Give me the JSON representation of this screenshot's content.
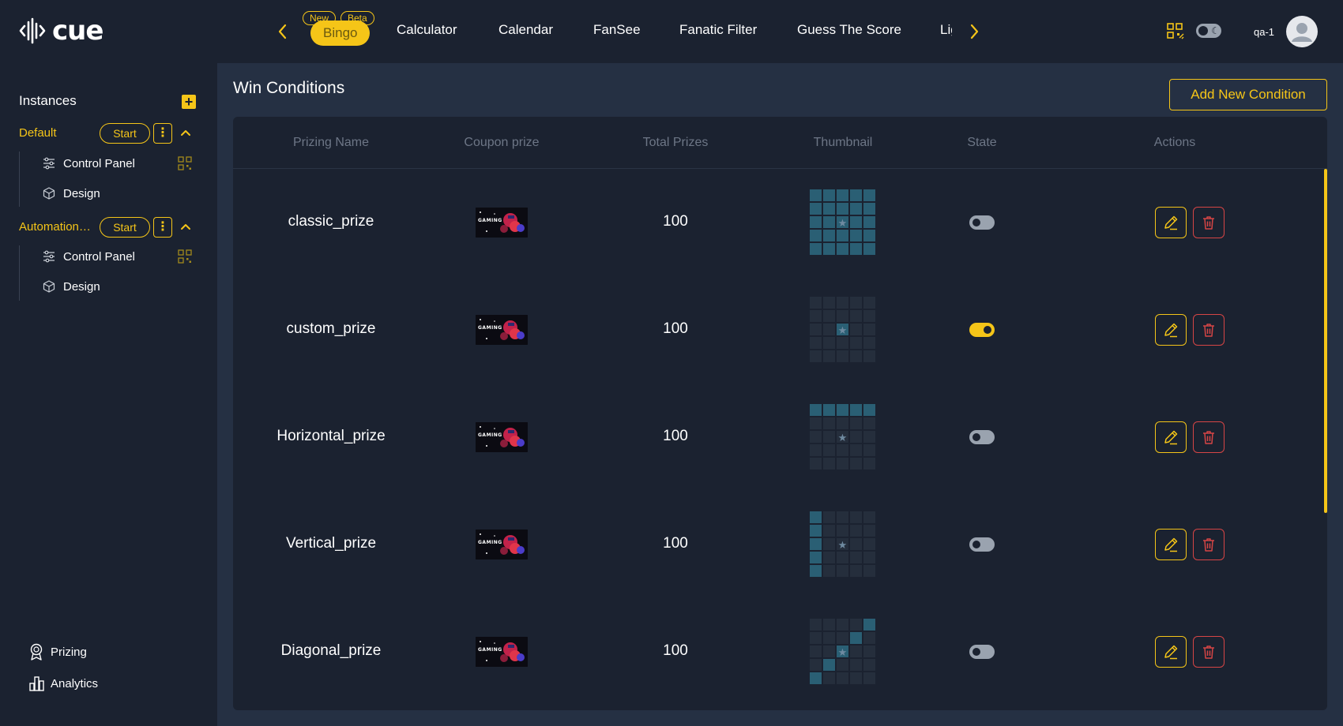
{
  "app": {
    "logo_text": "cue"
  },
  "nav": {
    "tabs": [
      {
        "label": "Bingo",
        "active": true,
        "tags": [
          "New",
          "Beta"
        ]
      },
      {
        "label": "Calculator"
      },
      {
        "label": "Calendar"
      },
      {
        "label": "FanSee"
      },
      {
        "label": "Fanatic Filter"
      },
      {
        "label": "Guess The Score"
      },
      {
        "label": "Lig"
      }
    ],
    "prev_icon": "chevron-left-icon",
    "next_icon": "chevron-right-icon"
  },
  "header": {
    "user_name": "qa-1",
    "theme_toggle_icon": "moon-icon",
    "qr_icon": "qr-code-icon"
  },
  "sidebar": {
    "title": "Instances",
    "add_icon": "plus-icon",
    "instances": [
      {
        "name": "Default",
        "start_label": "Start",
        "items": [
          {
            "label": "Control Panel",
            "icon": "sliders-icon"
          },
          {
            "label": "Design",
            "icon": "cube-icon"
          }
        ]
      },
      {
        "name": "Automation_...",
        "start_label": "Start",
        "items": [
          {
            "label": "Control Panel",
            "icon": "sliders-icon"
          },
          {
            "label": "Design",
            "icon": "cube-icon"
          }
        ]
      }
    ],
    "bottom": [
      {
        "label": "Prizing",
        "icon": "award-icon"
      },
      {
        "label": "Analytics",
        "icon": "bar-chart-icon"
      }
    ]
  },
  "main": {
    "title": "Win Conditions",
    "add_button": "Add New Condition",
    "columns": [
      "Prizing Name",
      "Coupon prize",
      "Total Prizes",
      "Thumbnail",
      "State",
      "Actions"
    ],
    "coupon_text": "GAMING",
    "rows": [
      {
        "name": "classic_prize",
        "total": "100",
        "state": false,
        "pattern": "full"
      },
      {
        "name": "custom_prize",
        "total": "100",
        "state": true,
        "pattern": "custom"
      },
      {
        "name": "Horizontal_prize",
        "total": "100",
        "state": false,
        "pattern": "horizontal"
      },
      {
        "name": "Vertical_prize",
        "total": "100",
        "state": false,
        "pattern": "vertical"
      },
      {
        "name": "Diagonal_prize",
        "total": "100",
        "state": false,
        "pattern": "diagonal"
      }
    ]
  },
  "colors": {
    "accent": "#f5c518",
    "danger": "#d64545",
    "cell_on": "#2a5f74",
    "cell_off": "#252e3c",
    "bg": "#1b2230",
    "panel": "#253043"
  }
}
